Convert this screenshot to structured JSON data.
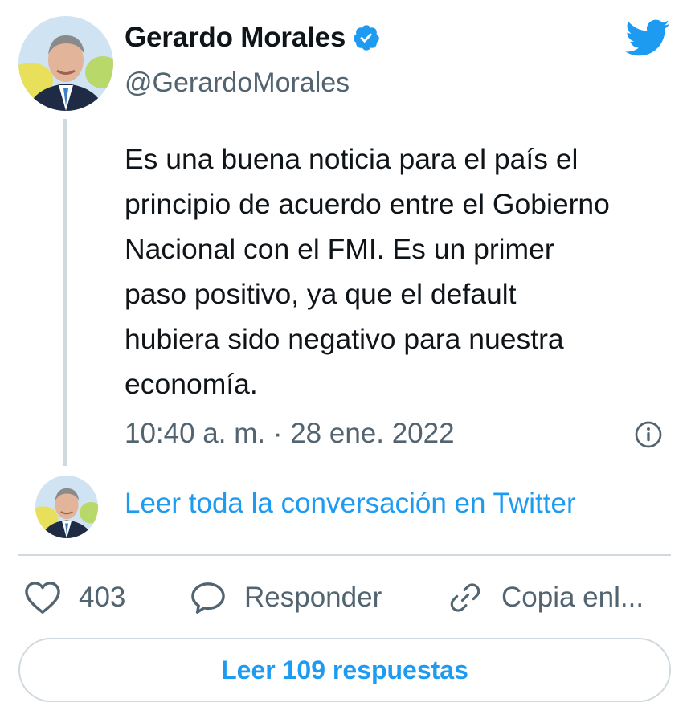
{
  "author": {
    "display_name": "Gerardo Morales",
    "handle": "@GerardoMorales",
    "verified": true
  },
  "tweet": {
    "text": "Es una buena noticia para el país el\nprincipio de acuerdo entre el Gobierno\nNacional con el FMI. Es un primer\npaso positivo, ya que el default\nhubiera sido negativo para nuestra\neconomía.",
    "timestamp": "10:40 a. m. · 28 ene. 2022"
  },
  "conversation_link": "Leer toda la conversación en Twitter",
  "actions": {
    "like_count": "403",
    "reply_label": "Responder",
    "copy_label": "Copia enl..."
  },
  "replies_button": "Leer 109 respuestas",
  "icons": {
    "brand": "twitter-bird-icon",
    "verified": "verified-badge-icon",
    "info": "info-icon",
    "like": "heart-icon",
    "reply": "speech-bubble-icon",
    "copy": "link-icon"
  },
  "colors": {
    "accent": "#1d9bf0",
    "text": "#0f1419",
    "secondary": "#536471",
    "border": "#cfd9de"
  }
}
